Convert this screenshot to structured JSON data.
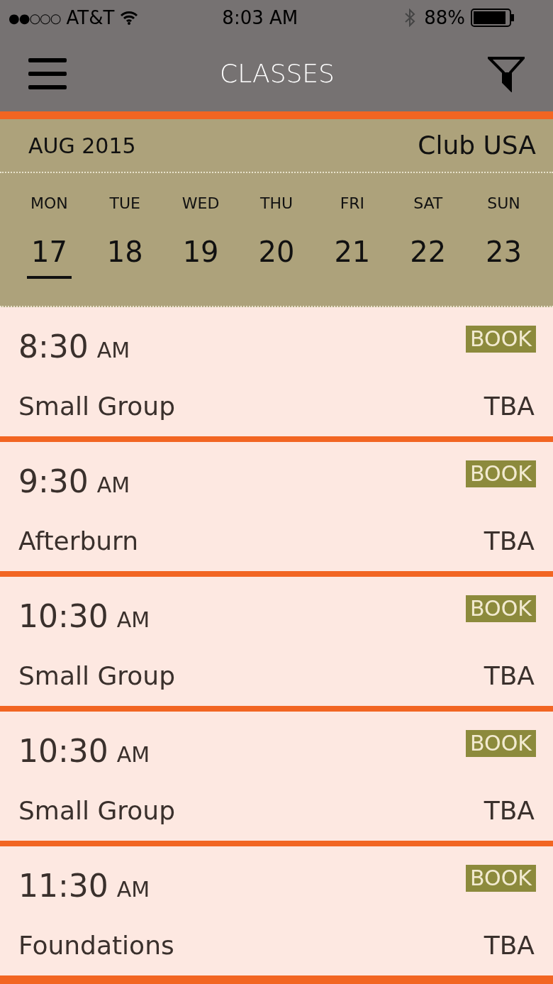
{
  "status_bar": {
    "signal": "●●○○○",
    "carrier": "AT&T",
    "time": "8:03 AM",
    "battery": "88%"
  },
  "header": {
    "title": "CLASSES"
  },
  "calendar": {
    "month": "AUG",
    "year": "2015",
    "club": "Club USA",
    "days": [
      {
        "weekday": "MON",
        "date": "17",
        "selected": true
      },
      {
        "weekday": "TUE",
        "date": "18",
        "selected": false
      },
      {
        "weekday": "WED",
        "date": "19",
        "selected": false
      },
      {
        "weekday": "THU",
        "date": "20",
        "selected": false
      },
      {
        "weekday": "FRI",
        "date": "21",
        "selected": false
      },
      {
        "weekday": "SAT",
        "date": "22",
        "selected": false
      },
      {
        "weekday": "SUN",
        "date": "23",
        "selected": false
      }
    ]
  },
  "classes": [
    {
      "time": "8:30",
      "period": "AM",
      "name": "Small Group",
      "instructor": "TBA",
      "button": "BOOK"
    },
    {
      "time": "9:30",
      "period": "AM",
      "name": "Afterburn",
      "instructor": "TBA",
      "button": "BOOK"
    },
    {
      "time": "10:30",
      "period": "AM",
      "name": "Small Group",
      "instructor": "TBA",
      "button": "BOOK"
    },
    {
      "time": "10:30",
      "period": "AM",
      "name": "Small Group",
      "instructor": "TBA",
      "button": "BOOK"
    },
    {
      "time": "11:30",
      "period": "AM",
      "name": "Foundations",
      "instructor": "TBA",
      "button": "BOOK"
    }
  ]
}
